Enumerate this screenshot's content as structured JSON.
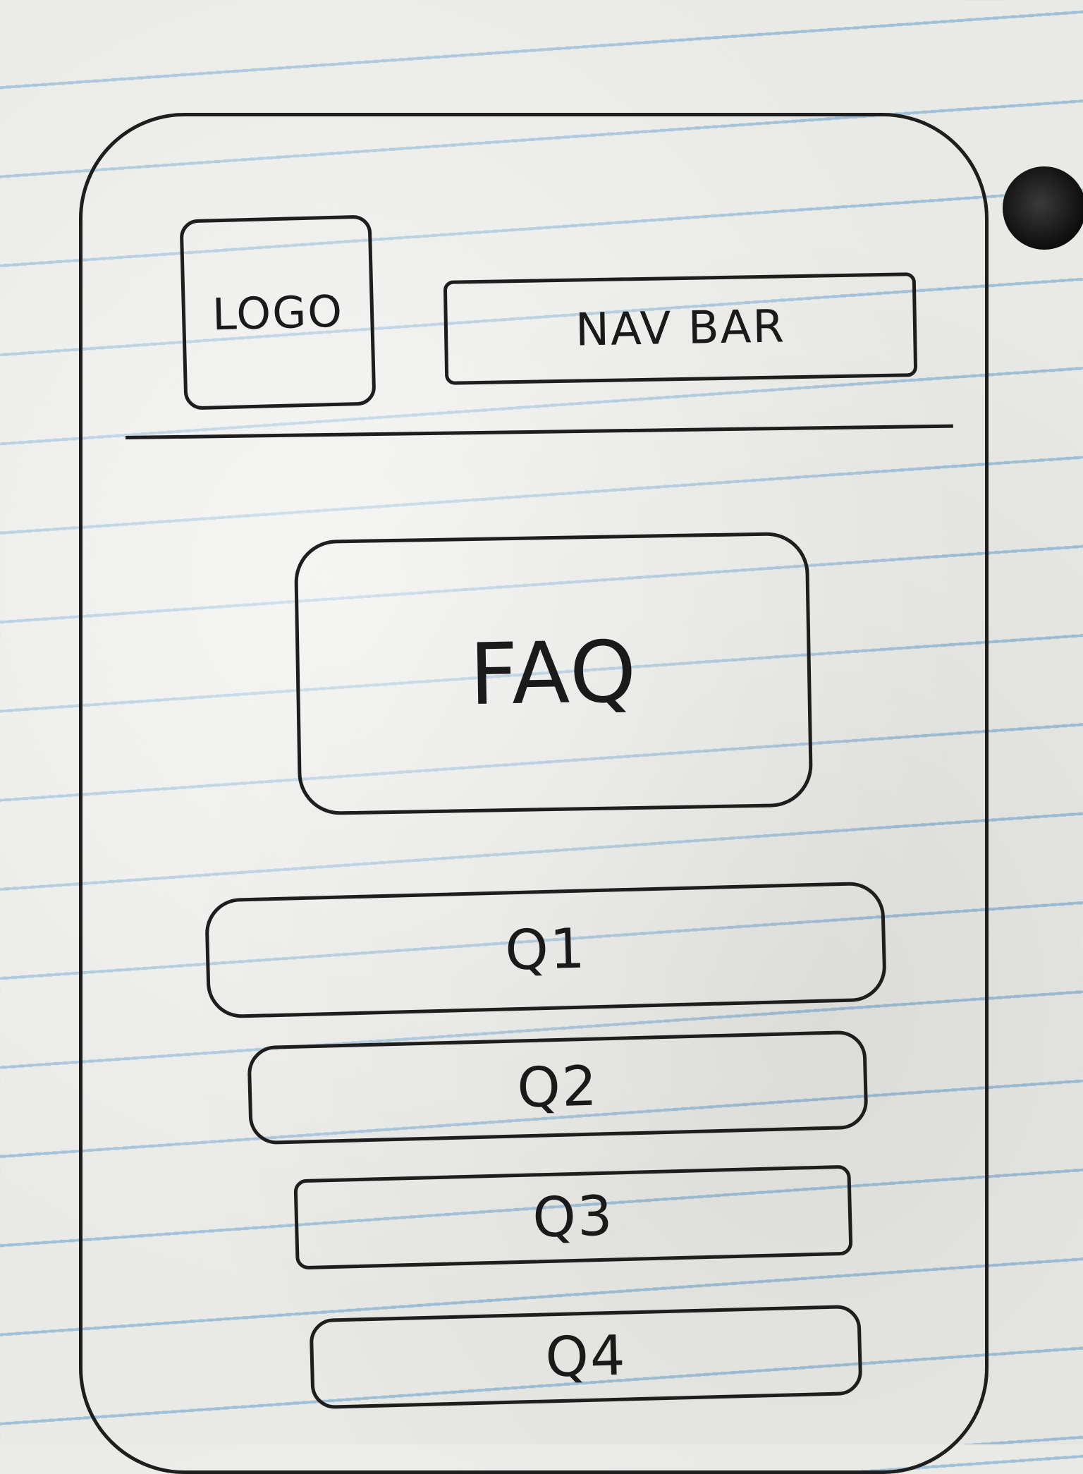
{
  "header": {
    "logo_label": "LOGO",
    "nav_label": "NAV BAR"
  },
  "hero": {
    "title": "FAQ"
  },
  "faq": {
    "questions": [
      {
        "label": "Q1"
      },
      {
        "label": "Q2"
      },
      {
        "label": "Q3"
      },
      {
        "label": "Q4"
      }
    ]
  }
}
